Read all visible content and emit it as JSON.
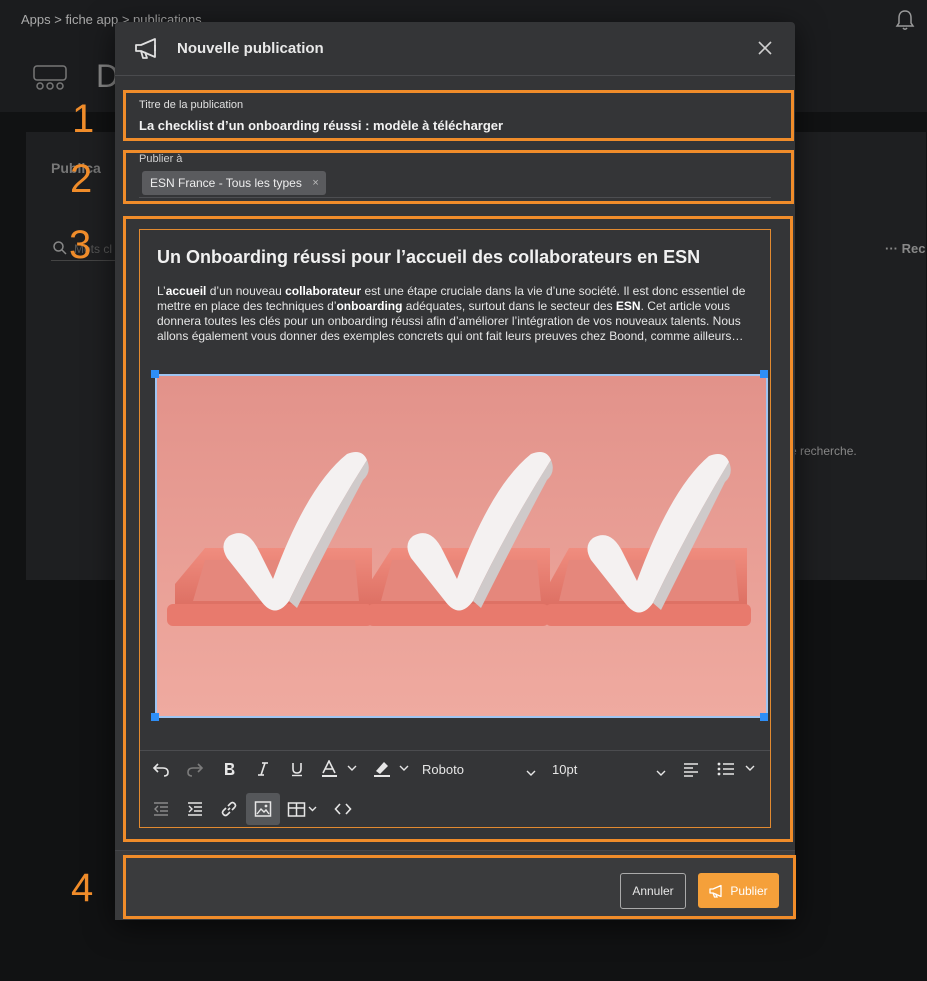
{
  "background": {
    "breadcrumb": "Apps > fiche app > publications",
    "big_letter": "D",
    "panel_label": "Publica",
    "search_placeholder": "Mots cl",
    "more_label": "··· Rec",
    "hint_text": "e recherche."
  },
  "modal": {
    "title": "Nouvelle publication",
    "title_field": {
      "label": "Titre de la publication",
      "value": "La checklist d’un onboarding réussi : modèle à télécharger"
    },
    "publish_to": {
      "label": "Publier à",
      "chips": [
        {
          "label": "ESN France - Tous les types",
          "remove": "×"
        }
      ]
    },
    "editor": {
      "heading": "Un Onboarding réussi pour l’accueil des collaborateurs en ESN",
      "body_parts": [
        {
          "text": "L’",
          "bold": false
        },
        {
          "text": "accueil",
          "bold": true
        },
        {
          "text": " d’un nouveau ",
          "bold": false
        },
        {
          "text": "collaborateur",
          "bold": true
        },
        {
          "text": " est une étape cruciale dans la vie d’une société. Il est donc essentiel de mettre en place des techniques d’",
          "bold": false
        },
        {
          "text": "onboarding",
          "bold": true
        },
        {
          "text": " adéquates, surtout dans le secteur des ",
          "bold": false
        },
        {
          "text": "ESN",
          "bold": true
        },
        {
          "text": ". Cet article vous donnera toutes les clés pour un onboarding réussi afin d’améliorer l’intégration de vos nouveaux talents. Nous allons également vous donner des exemples concrets qui ont fait leurs preuves chez Boond, comme ailleurs…",
          "bold": false
        }
      ],
      "toolbar": {
        "font_family": "Roboto",
        "font_size": "10pt"
      }
    },
    "footer": {
      "cancel_label": "Annuler",
      "publish_label": "Publier"
    }
  },
  "annotations": [
    "1",
    "2",
    "3",
    "4"
  ],
  "colors": {
    "accent": "#f5a03a",
    "annotation": "#f08c2a",
    "selection": "#2e8ef7"
  }
}
